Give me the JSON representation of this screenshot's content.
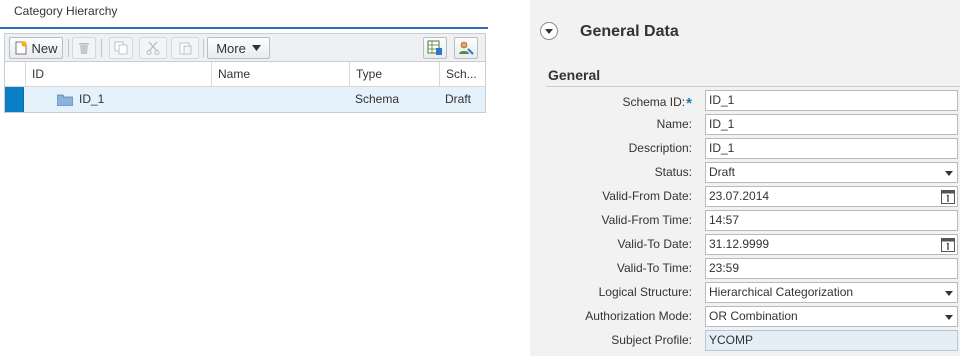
{
  "left": {
    "title": "Category Hierarchy",
    "toolbar": {
      "new_label": "New",
      "more_label": "More"
    },
    "columns": [
      "ID",
      "Name",
      "Type",
      "Sch..."
    ],
    "rows": [
      {
        "id": "ID_1",
        "name": "",
        "type": "Schema",
        "status": "Draft"
      }
    ]
  },
  "right": {
    "section_title": "General Data",
    "group_title": "General",
    "fields": [
      {
        "label": "Schema ID:",
        "value": "ID_1"
      },
      {
        "label": "Name:",
        "value": "ID_1"
      },
      {
        "label": "Description:",
        "value": "ID_1"
      },
      {
        "label": "Status:",
        "value": "Draft"
      },
      {
        "label": "Valid-From Date:",
        "value": "23.07.2014"
      },
      {
        "label": "Valid-From Time:",
        "value": "14:57"
      },
      {
        "label": "Valid-To Date:",
        "value": "31.12.9999"
      },
      {
        "label": "Valid-To Time:",
        "value": "23:59"
      },
      {
        "label": "Logical Structure:",
        "value": "Hierarchical Categorization"
      },
      {
        "label": "Authorization Mode:",
        "value": "OR Combination"
      },
      {
        "label": "Subject Profile:",
        "value": "YCOMP"
      }
    ],
    "required_marker": "*"
  },
  "colors": {
    "accent": "#2a6fb8",
    "row_selected": "#e5f1fb",
    "selection_marker": "#0a7fc6",
    "right_pane_bg": "#f2f2f2"
  }
}
